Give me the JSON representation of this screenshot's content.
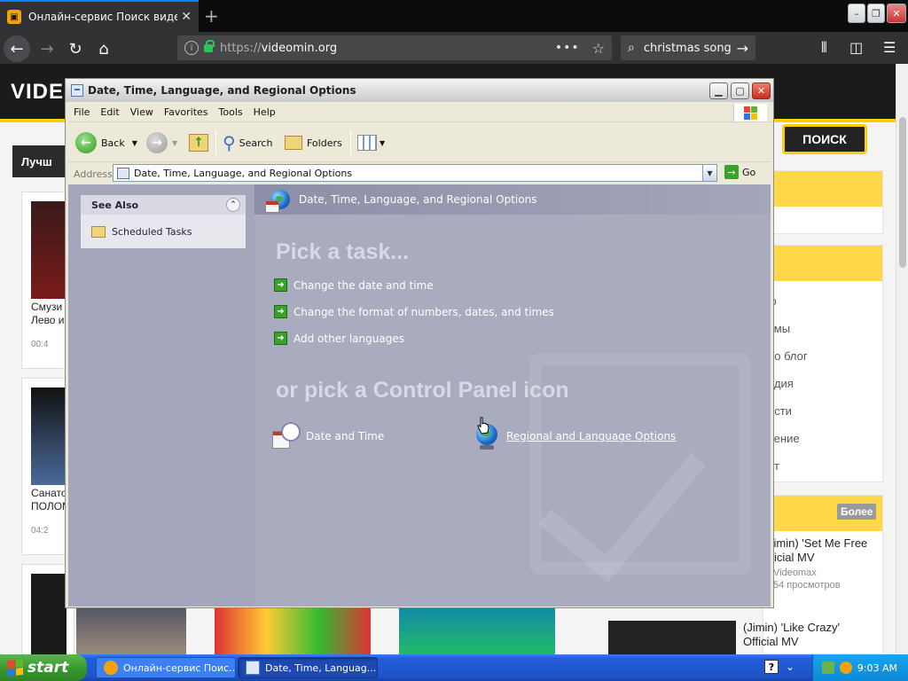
{
  "browser": {
    "tab_title": "Онлайн-сервис Поиск видео и с",
    "url_protocol": "https://",
    "url_host": "videomin.org",
    "search_text": "christmas song"
  },
  "site": {
    "logo": "VIDE",
    "search_button": "ПОИСК",
    "sidebar_label": "Лучш",
    "cards": [
      {
        "title": "Смузи Лево и",
        "duration": "00:4"
      },
      {
        "title": "Санато ПОЛОМ",
        "duration": "04:2"
      }
    ],
    "categories": [
      "ю",
      "ьмы",
      "ео блог",
      "едия",
      "ости",
      "чение",
      "рт"
    ],
    "more_label": "Более",
    "videos": [
      {
        "title": "Jimin) 'Set Me Free fficial MV",
        "channel": "Videomax",
        "views": "54 просмотров"
      },
      {
        "title": "(Jimin) 'Like Crazy' Official MV",
        "channel": "",
        "views": ""
      }
    ]
  },
  "window": {
    "title": "Date, Time, Language, and Regional Options",
    "menu": [
      "File",
      "Edit",
      "View",
      "Favorites",
      "Tools",
      "Help"
    ],
    "toolbar": {
      "back": "Back",
      "search": "Search",
      "folders": "Folders"
    },
    "address_label": "Address",
    "address_value": "Date, Time, Language, and Regional Options",
    "go_label": "Go",
    "see_also": {
      "header": "See Also",
      "items": [
        "Scheduled Tasks"
      ]
    },
    "banner": "Date, Time, Language, and Regional Options",
    "pick_task": "Pick a task...",
    "tasks": [
      "Change the date and time",
      "Change the format of numbers, dates, and times",
      "Add other languages"
    ],
    "or_pick": "or pick a Control Panel icon",
    "icons": [
      "Date and Time",
      "Regional and Language Options"
    ]
  },
  "taskbar": {
    "start": "start",
    "buttons": [
      "Онлайн-сервис Поис...",
      "Date, Time, Languag..."
    ],
    "clock": "9:03 AM"
  }
}
